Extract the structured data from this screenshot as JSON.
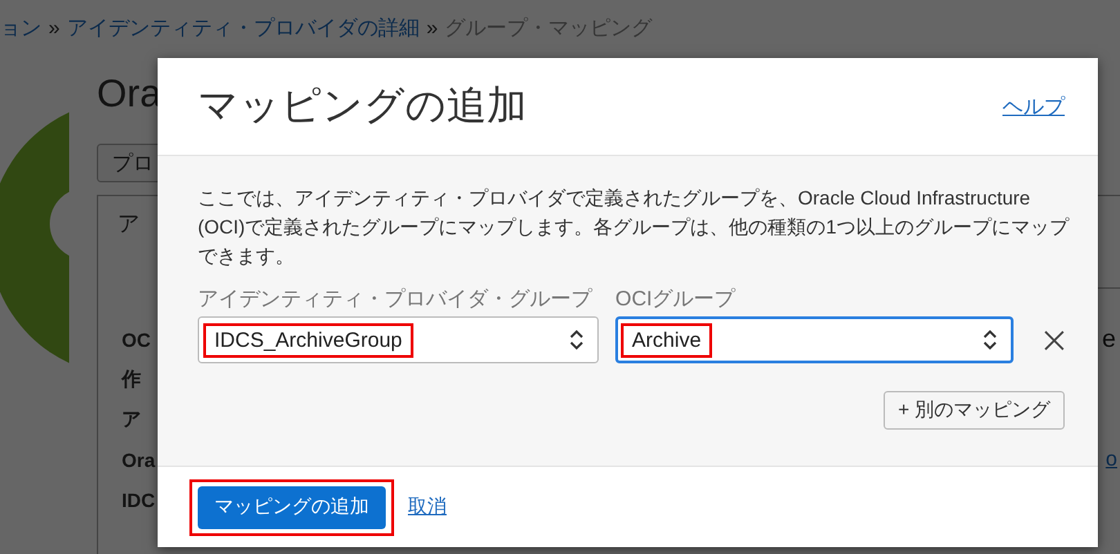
{
  "background_page": {
    "breadcrumb": [
      {
        "label": "ョン",
        "kind": "link"
      },
      {
        "label": "»",
        "kind": "separator"
      },
      {
        "label": "アイデンティティ・プロバイダの詳細",
        "kind": "link"
      },
      {
        "label": "»",
        "kind": "separator"
      },
      {
        "label": "グループ・マッピング",
        "kind": "current"
      }
    ],
    "title": "Ora",
    "button": "プロ",
    "tab": "ア",
    "rows": [
      {
        "label": "OC",
        "value": "e"
      },
      {
        "label": "作"
      },
      {
        "label": "ア"
      },
      {
        "label": "Ora",
        "link": "o"
      },
      {
        "label": "IDC"
      }
    ]
  },
  "dialog": {
    "title": "マッピングの追加",
    "help_link": "ヘルプ",
    "description": "ここでは、アイデンティティ・プロバイダで定義されたグループを、Oracle Cloud Infrastructure (OCI)で定義されたグループにマップします。各グループは、他の種類の1つ以上のグループにマップできます。",
    "mapping": {
      "fields": [
        {
          "label": "アイデンティティ・プロバイダ・グループ",
          "value": "IDCS_ArchiveGroup",
          "focused": false,
          "highlighted": true
        },
        {
          "label": "OCIグループ",
          "value": "Archive",
          "focused": true,
          "highlighted": true
        }
      ],
      "removable": true
    },
    "add_mapping_button": "+ 別のマッピング",
    "primary_button": {
      "label": "マッピングの追加",
      "highlighted": true
    },
    "cancel_link": "取消"
  }
}
